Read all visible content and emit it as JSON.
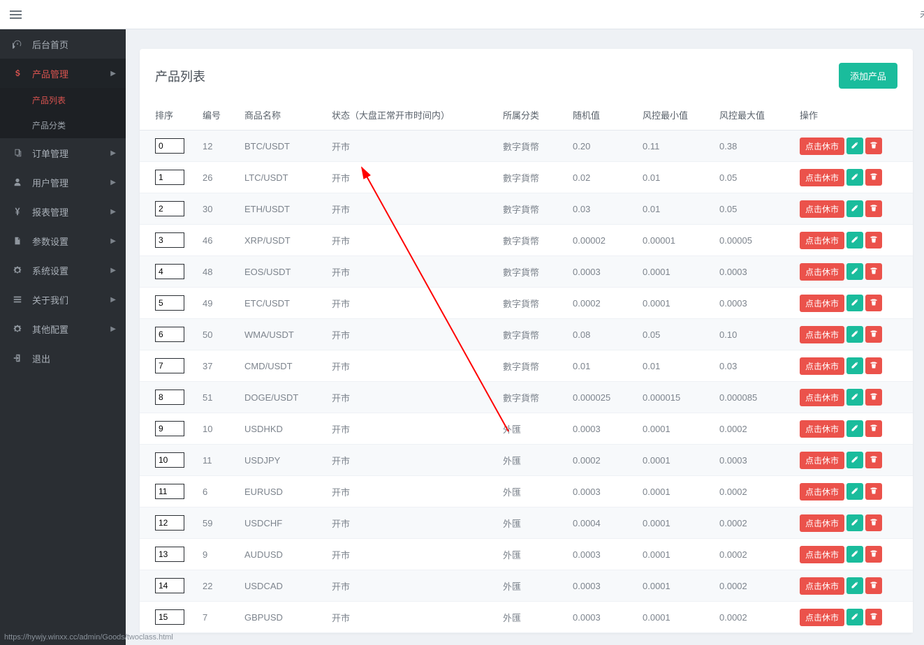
{
  "top_right_text": "未登",
  "status_bar": "https://hywjy.winxx.cc/admin/Goods/twoclass.html",
  "sidebar": {
    "items": [
      {
        "icon": "dashboard",
        "label": "后台首页",
        "arrow": false
      },
      {
        "icon": "bitcoin",
        "label": "产品管理",
        "arrow": true,
        "active": true,
        "children": [
          {
            "label": "产品列表",
            "active": true
          },
          {
            "label": "产品分类",
            "active": false
          }
        ]
      },
      {
        "icon": "copy",
        "label": "订单管理",
        "arrow": true
      },
      {
        "icon": "user",
        "label": "用户管理",
        "arrow": true
      },
      {
        "icon": "yen",
        "label": "报表管理",
        "arrow": true
      },
      {
        "icon": "file",
        "label": "参数设置",
        "arrow": true
      },
      {
        "icon": "cog",
        "label": "系统设置",
        "arrow": true
      },
      {
        "icon": "bars",
        "label": "关于我们",
        "arrow": true
      },
      {
        "icon": "cog",
        "label": "其他配置",
        "arrow": true
      },
      {
        "icon": "signout",
        "label": "退出",
        "arrow": false
      }
    ]
  },
  "panel": {
    "title": "产品列表",
    "add_button": "添加产品",
    "headers": {
      "sort": "排序",
      "id": "编号",
      "name": "商品名称",
      "status": "状态（大盘正常开市时间内）",
      "category": "所属分类",
      "random": "随机值",
      "min": "风控最小值",
      "max": "风控最大值",
      "ops": "操作"
    },
    "action_label": "点击休市",
    "rows": [
      {
        "sort": "0",
        "id": "12",
        "name": "BTC/USDT",
        "status": "开市",
        "category": "數字貨幣",
        "random": "0.20",
        "min": "0.11",
        "max": "0.38"
      },
      {
        "sort": "1",
        "id": "26",
        "name": "LTC/USDT",
        "status": "开市",
        "category": "數字貨幣",
        "random": "0.02",
        "min": "0.01",
        "max": "0.05"
      },
      {
        "sort": "2",
        "id": "30",
        "name": "ETH/USDT",
        "status": "开市",
        "category": "數字貨幣",
        "random": "0.03",
        "min": "0.01",
        "max": "0.05"
      },
      {
        "sort": "3",
        "id": "46",
        "name": "XRP/USDT",
        "status": "开市",
        "category": "數字貨幣",
        "random": "0.00002",
        "min": "0.00001",
        "max": "0.00005"
      },
      {
        "sort": "4",
        "id": "48",
        "name": "EOS/USDT",
        "status": "开市",
        "category": "數字貨幣",
        "random": "0.0003",
        "min": "0.0001",
        "max": "0.0003"
      },
      {
        "sort": "5",
        "id": "49",
        "name": "ETC/USDT",
        "status": "开市",
        "category": "數字貨幣",
        "random": "0.0002",
        "min": "0.0001",
        "max": "0.0003"
      },
      {
        "sort": "6",
        "id": "50",
        "name": "WMA/USDT",
        "status": "开市",
        "category": "數字貨幣",
        "random": "0.08",
        "min": "0.05",
        "max": "0.10"
      },
      {
        "sort": "7",
        "id": "37",
        "name": "CMD/USDT",
        "status": "开市",
        "category": "數字貨幣",
        "random": "0.01",
        "min": "0.01",
        "max": "0.03"
      },
      {
        "sort": "8",
        "id": "51",
        "name": "DOGE/USDT",
        "status": "开市",
        "category": "數字貨幣",
        "random": "0.000025",
        "min": "0.000015",
        "max": "0.000085"
      },
      {
        "sort": "9",
        "id": "10",
        "name": "USDHKD",
        "status": "开市",
        "category": "外匯",
        "random": "0.0003",
        "min": "0.0001",
        "max": "0.0002"
      },
      {
        "sort": "10",
        "id": "11",
        "name": "USDJPY",
        "status": "开市",
        "category": "外匯",
        "random": "0.0002",
        "min": "0.0001",
        "max": "0.0003"
      },
      {
        "sort": "11",
        "id": "6",
        "name": "EURUSD",
        "status": "开市",
        "category": "外匯",
        "random": "0.0003",
        "min": "0.0001",
        "max": "0.0002"
      },
      {
        "sort": "12",
        "id": "59",
        "name": "USDCHF",
        "status": "开市",
        "category": "外匯",
        "random": "0.0004",
        "min": "0.0001",
        "max": "0.0002"
      },
      {
        "sort": "13",
        "id": "9",
        "name": "AUDUSD",
        "status": "开市",
        "category": "外匯",
        "random": "0.0003",
        "min": "0.0001",
        "max": "0.0002"
      },
      {
        "sort": "14",
        "id": "22",
        "name": "USDCAD",
        "status": "开市",
        "category": "外匯",
        "random": "0.0003",
        "min": "0.0001",
        "max": "0.0002"
      },
      {
        "sort": "15",
        "id": "7",
        "name": "GBPUSD",
        "status": "开市",
        "category": "外匯",
        "random": "0.0003",
        "min": "0.0001",
        "max": "0.0002"
      }
    ]
  }
}
